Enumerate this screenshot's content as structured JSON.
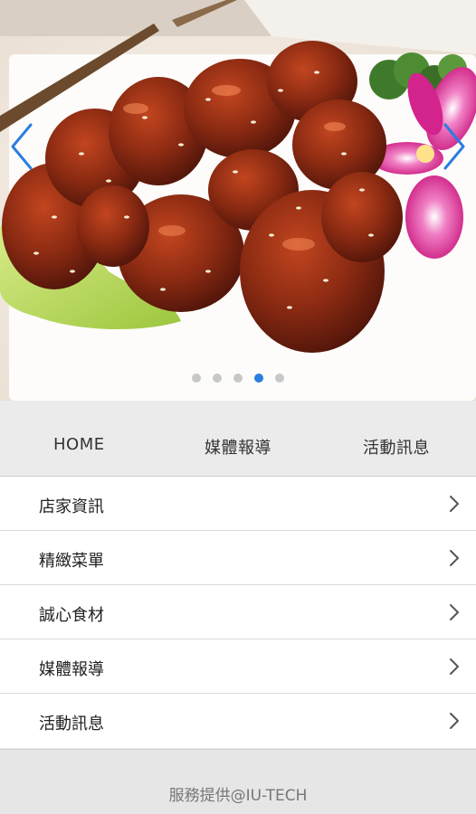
{
  "carousel": {
    "image_name": "sweet-and-sour-pork-photo",
    "slide_count": 5,
    "active_index": 3,
    "arrow_color": "#2a7de1",
    "dot_color": "#c8c8c8",
    "dot_active_color": "#2a7de1"
  },
  "nav": {
    "items": [
      {
        "label": "HOME"
      },
      {
        "label": "媒體報導"
      },
      {
        "label": "活動訊息"
      }
    ]
  },
  "menu": {
    "items": [
      {
        "label": "店家資訊"
      },
      {
        "label": "精緻菜單"
      },
      {
        "label": "誠心食材"
      },
      {
        "label": "媒體報導"
      },
      {
        "label": "活動訊息"
      }
    ],
    "chevron_icon": "chevron-right-icon"
  },
  "footer": {
    "text": "服務提供@IU-TECH"
  }
}
